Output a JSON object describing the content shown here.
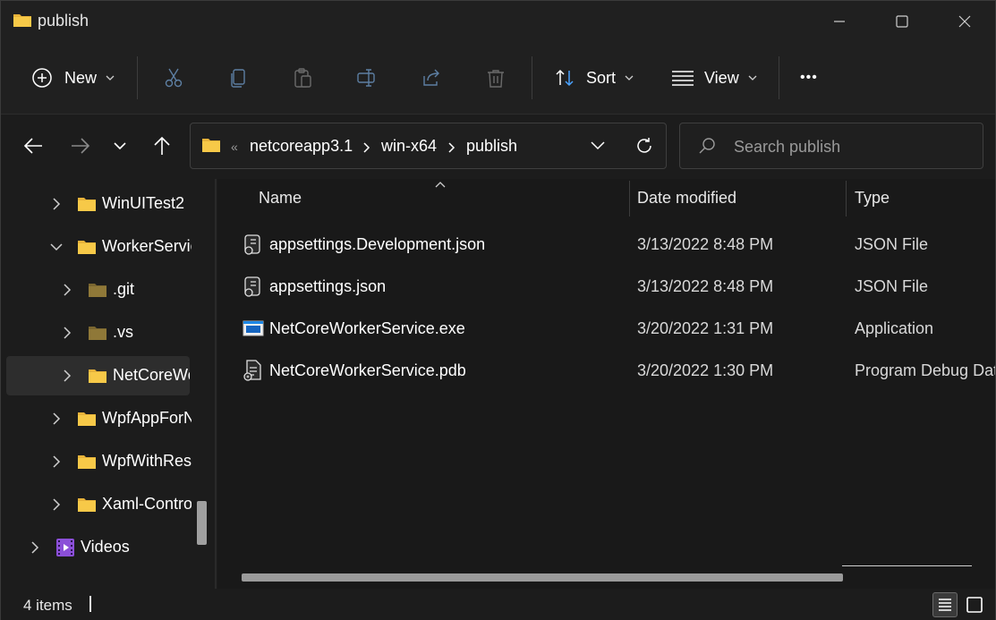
{
  "window": {
    "title": "publish"
  },
  "toolbar": {
    "new_label": "New",
    "sort_label": "Sort",
    "view_label": "View",
    "more_label": "•••"
  },
  "address": {
    "overflow": "«",
    "crumbs": [
      "netcoreapp3.1",
      "win-x64",
      "publish"
    ]
  },
  "search": {
    "placeholder": "Search publish"
  },
  "sidebar": {
    "items": [
      {
        "label": "WinUITest2"
      },
      {
        "label": "WorkerService"
      },
      {
        "label": ".git"
      },
      {
        "label": ".vs"
      },
      {
        "label": "NetCoreWorkerService"
      },
      {
        "label": "WpfAppForNet"
      },
      {
        "label": "WpfWithResources"
      },
      {
        "label": "Xaml-Controls"
      },
      {
        "label": "Videos"
      }
    ]
  },
  "columns": {
    "name": "Name",
    "date": "Date modified",
    "type": "Type"
  },
  "files": [
    {
      "name": "appsettings.Development.json",
      "date": "3/13/2022 8:48 PM",
      "type": "JSON File",
      "icon": "json-file-icon"
    },
    {
      "name": "appsettings.json",
      "date": "3/13/2022 8:48 PM",
      "type": "JSON File",
      "icon": "json-file-icon"
    },
    {
      "name": "NetCoreWorkerService.exe",
      "date": "3/20/2022 1:31 PM",
      "type": "Application",
      "icon": "application-icon"
    },
    {
      "name": "NetCoreWorkerService.pdb",
      "date": "3/20/2022 1:30 PM",
      "type": "Program Debug Database",
      "icon": "pdb-file-icon"
    }
  ],
  "status": {
    "count": "4 items"
  },
  "colors": {
    "accent": "#0078d4",
    "folder": "#f5c242"
  }
}
